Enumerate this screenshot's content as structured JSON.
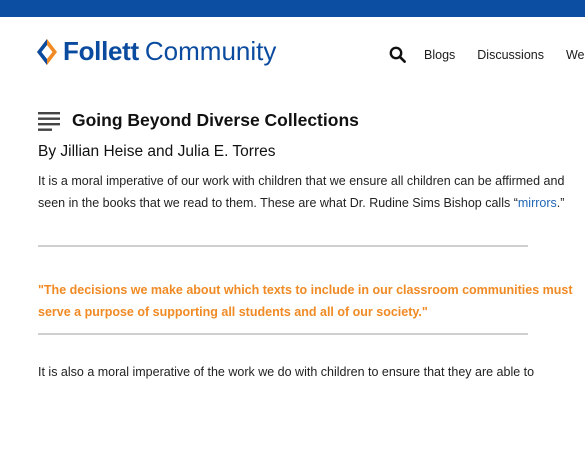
{
  "colors": {
    "topbar": "#0b4ea2",
    "brand": "#0a4b9f",
    "logo_mark": "#f08a24",
    "link": "#2066b5",
    "quote": "#f08a24",
    "rule": "#cfcfcf"
  },
  "header": {
    "logo_bold": "Follett",
    "logo_light": "Community",
    "nav": {
      "search_icon": "search-icon",
      "items": [
        "Blogs",
        "Discussions",
        "We"
      ]
    }
  },
  "article": {
    "menu_icon": "menu-lines-icon",
    "title": "Going Beyond Diverse Collections",
    "byline": "By Jillian Heise and Julia E. Torres",
    "para1_text": "It is a moral imperative of our work with children that we ensure all children can be affirmed and seen in the books that we read to them. These are what Dr. Rudine Sims Bishop calls “",
    "para1_link": "mirrors",
    "para1_end": ".”",
    "quote": "\"The decisions we make about which texts to include in our classroom communities must serve a purpose of supporting all students and all of our society.\"",
    "para2_text": "It is also a moral imperative of the work we do with children to ensure that they are able to"
  }
}
